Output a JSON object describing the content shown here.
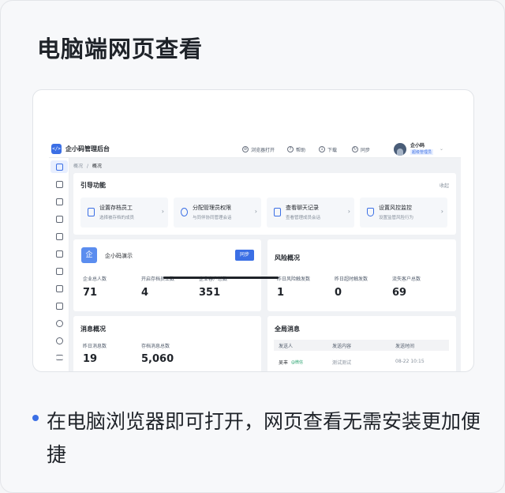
{
  "heading": "电脑端网页查看",
  "caption": "在电脑浏览器即可打开，网页查看无需安装更加便捷",
  "colors": {
    "accent": "#3b6fe5",
    "background": "#f7f8fa"
  },
  "app": {
    "logo": "</>",
    "title": "企小码管理后台",
    "toolbar": [
      {
        "label": "浏览器打开",
        "icon": "compass-icon"
      },
      {
        "label": "帮助",
        "icon": "help-icon"
      },
      {
        "label": "下载",
        "icon": "download-icon"
      },
      {
        "label": "同步",
        "icon": "sync-icon"
      }
    ],
    "user": {
      "name": "企小码",
      "role": "超级管理员"
    },
    "breadcrumb": {
      "root": "概况",
      "sep": "/",
      "current": "概况"
    },
    "guide": {
      "title": "引导功能",
      "collapse": "收起",
      "items": [
        {
          "title": "设置存档员工",
          "sub": "选择被存档的成员"
        },
        {
          "title": "分配管理员权限",
          "sub": "与同伴协同管理会话"
        },
        {
          "title": "查看聊天记录",
          "sub": "查看管理成员会话"
        },
        {
          "title": "设置风控监控",
          "sub": "设置监管风险行为"
        }
      ]
    },
    "company": {
      "icon": "企",
      "name": "企小码演示",
      "sync": "同步",
      "stats": [
        {
          "label": "企业总人数",
          "value": "71"
        },
        {
          "label": "开启存档员工数",
          "value": "4"
        },
        {
          "label": "企业客户总数",
          "value": "351"
        }
      ]
    },
    "risk": {
      "title": "风险概况",
      "stats": [
        {
          "label": "昨日风险触发数",
          "value": "1"
        },
        {
          "label": "昨日超时触发数",
          "value": "0"
        },
        {
          "label": "流失客户总数",
          "value": "69"
        }
      ]
    },
    "message": {
      "title": "消息概况",
      "stats": [
        {
          "label": "昨日消息数",
          "value": "19"
        },
        {
          "label": "存档消息总数",
          "value": "5,060"
        }
      ]
    },
    "global": {
      "title": "全局消息",
      "headers": [
        "发送人",
        "发送内容",
        "发送时间"
      ],
      "rows": [
        {
          "sender": "吴丰",
          "tag": "@微信",
          "content": "测试测试",
          "time": "08-22 10:15"
        }
      ]
    }
  }
}
